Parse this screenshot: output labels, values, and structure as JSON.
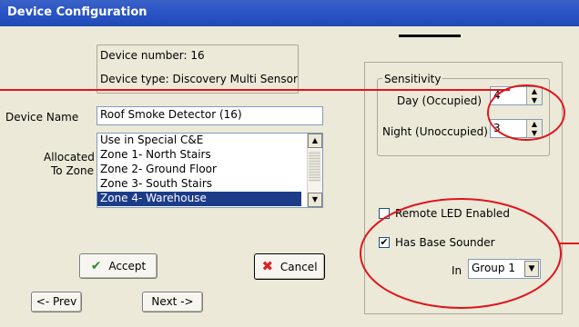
{
  "window": {
    "title": "Device Configuration"
  },
  "info": {
    "device_number": "Device number: 16",
    "device_type": "Device type: Discovery Multi Sensor"
  },
  "device_name": {
    "label": "Device Name",
    "value": "Roof Smoke Detector (16)"
  },
  "zone": {
    "label_line1": "Allocated",
    "label_line2": "To Zone",
    "items": [
      "Use in Special C&E",
      "Zone 1- North Stairs",
      "Zone 2- Ground Floor",
      "Zone 3- South Stairs",
      "Zone 4- Warehouse"
    ],
    "selected_index": 4
  },
  "buttons": {
    "accept": "Accept",
    "cancel": "Cancel",
    "prev": "<- Prev",
    "next": "Next ->"
  },
  "sensitivity": {
    "legend": "Sensitivity",
    "day_label": "Day (Occupied)",
    "day_value": "4",
    "night_label": "Night (Unoccupied)",
    "night_value": "3"
  },
  "options": {
    "remote_led_label": "Remote LED Enabled",
    "remote_led_checked": false,
    "base_sounder_label": "Has Base Sounder",
    "base_sounder_checked": true,
    "group_prefix": "In",
    "group_value": "Group 1"
  },
  "icons": {
    "accept": "checkmark-icon",
    "cancel": "x-icon"
  },
  "colors": {
    "titlebar": "#2c56c7",
    "selection": "#1c3c8a",
    "annotation": "#e0141c",
    "accept_icon": "#2e8b2e",
    "cancel_icon": "#e02020"
  }
}
